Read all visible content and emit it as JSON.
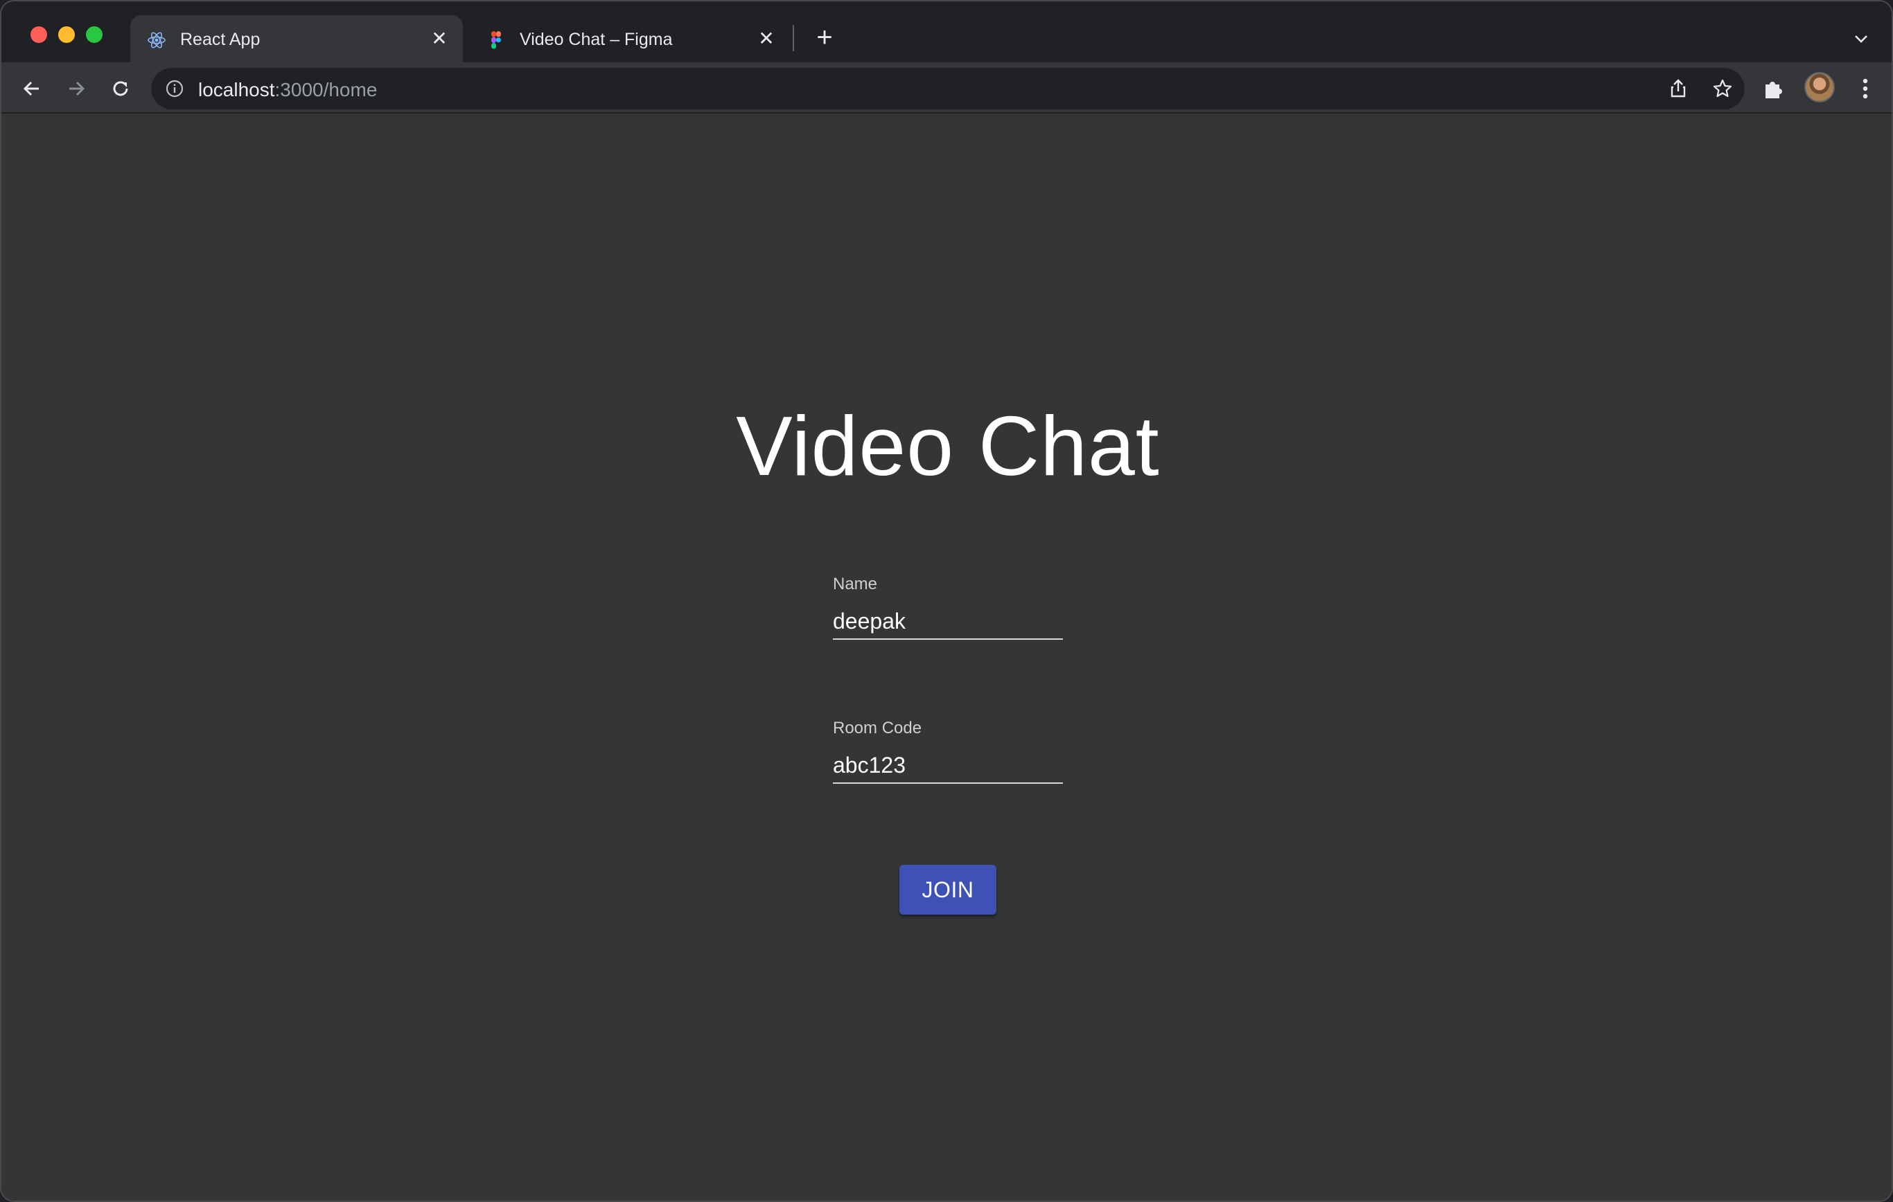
{
  "browser": {
    "tabs": [
      {
        "title": "React App",
        "icon": "react-icon",
        "active": true
      },
      {
        "title": "Video Chat – Figma",
        "icon": "figma-icon",
        "active": false
      }
    ],
    "address": {
      "host": "localhost",
      "rest": ":3000/home"
    }
  },
  "app": {
    "title": "Video Chat",
    "name_field": {
      "label": "Name",
      "value": "deepak"
    },
    "room_field": {
      "label": "Room Code",
      "value": "abc123"
    },
    "join_label": "JOIN"
  },
  "colors": {
    "page_bg": "#353535",
    "accent": "#3f51b5",
    "chrome_dark": "#202124",
    "chrome_mid": "#35363a"
  }
}
